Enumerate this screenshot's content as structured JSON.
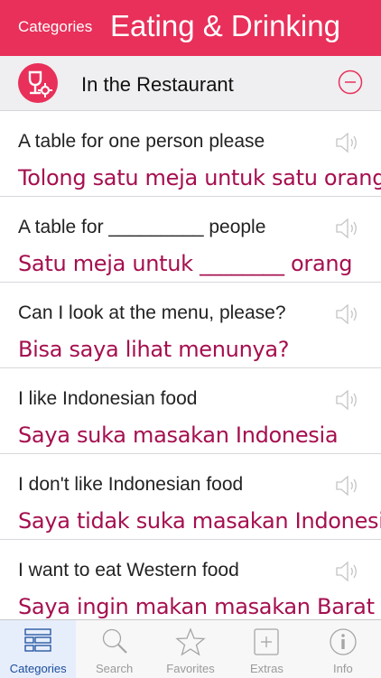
{
  "header": {
    "back_label": "Categories",
    "title": "Eating & Drinking"
  },
  "section": {
    "label": "In the Restaurant",
    "icon": "wineglass-icon",
    "accent": "#e8305a"
  },
  "phrases": [
    {
      "en": "A table for one person please",
      "tr": "Tolong satu meja untuk satu orang"
    },
    {
      "en": "A table for _________ people",
      "tr": "Satu meja untuk ________ orang"
    },
    {
      "en": "Can I look at the menu, please?",
      "tr": "Bisa saya lihat menunya?"
    },
    {
      "en": "I like Indonesian food",
      "tr": "Saya suka masakan Indonesia"
    },
    {
      "en": "I don't like Indonesian food",
      "tr": "Saya tidak suka masakan Indonesia"
    },
    {
      "en": "I want to eat Western food",
      "tr": "Saya ingin makan masakan Barat"
    }
  ],
  "tabs": [
    {
      "label": "Categories",
      "icon": "categories-list-icon",
      "active": true
    },
    {
      "label": "Search",
      "icon": "search-icon"
    },
    {
      "label": "Favorites",
      "icon": "star-icon"
    },
    {
      "label": "Extras",
      "icon": "plus-square-icon"
    },
    {
      "label": "Info",
      "icon": "info-icon"
    }
  ],
  "colors": {
    "header_bg": "#e8305a",
    "translation_text": "#a50f4f",
    "active_tab": "#1a4d9c"
  }
}
